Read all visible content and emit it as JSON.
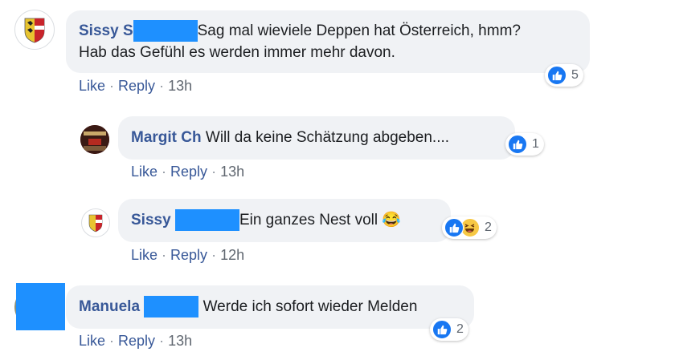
{
  "comments": [
    {
      "author": "Sissy",
      "author_suffix": "S",
      "text_line1": "Sag mal wieviele Deppen hat Österreich, hmm?",
      "text_line2": "Hab das Gefühl es werden immer mehr davon.",
      "reaction_count": "5",
      "time": "13h"
    },
    {
      "author": "Margit Ch",
      "text": "Will da keine Schätzung abgeben....",
      "reaction_count": "1",
      "time": "13h"
    },
    {
      "author": "Sissy",
      "text": "Ein ganzes Nest voll",
      "emoji": "😂",
      "reaction_count": "2",
      "time": "12h"
    },
    {
      "author": "Manuela",
      "text": "Werde ich sofort wieder Melden",
      "reaction_count": "2",
      "time": "13h"
    }
  ],
  "actions": {
    "like": "Like",
    "reply": "Reply",
    "separator": "·"
  },
  "colors": {
    "name": "#385898",
    "bubble": "#f0f2f5",
    "redaction": "#1e90ff",
    "like_blue": "#1877f2",
    "haha_yellow": "#f7c844"
  },
  "icons": {
    "like": "thumbs-up-icon",
    "haha": "laughing-face-icon"
  }
}
